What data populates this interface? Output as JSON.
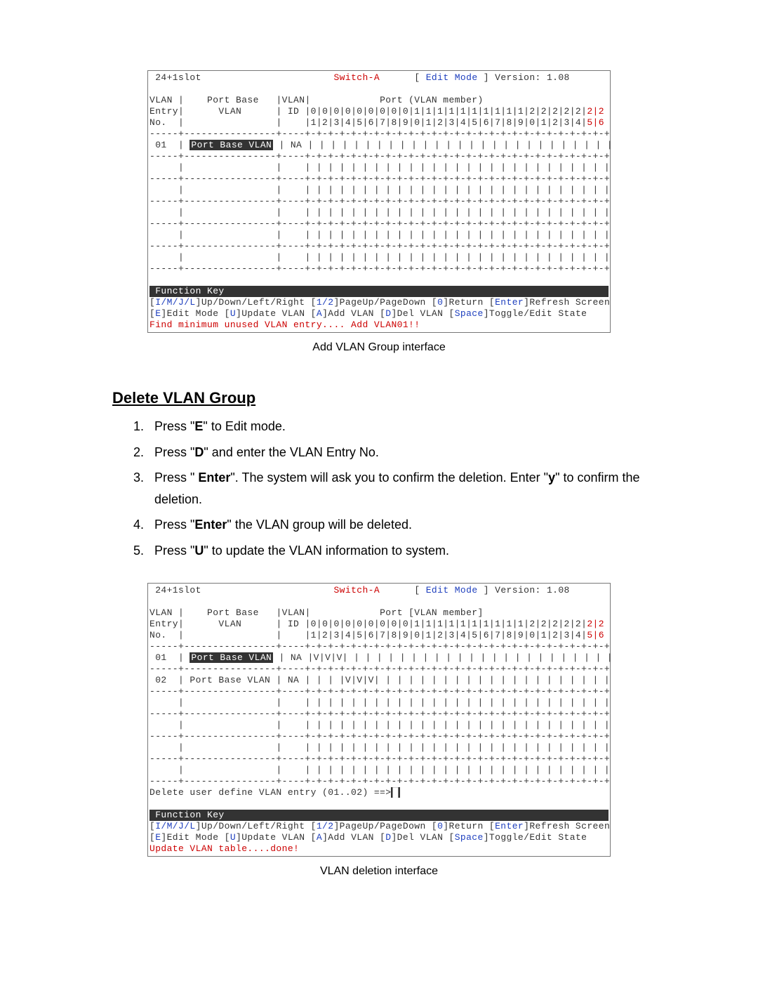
{
  "figure1": {
    "header_left": "24+1slot",
    "header_center": "Switch-A",
    "header_mode_l": "[ ",
    "header_mode": "Edit Mode",
    "header_mode_r": " ]",
    "header_version": "Version: 1.08",
    "col_entry_l1": "VLAN |",
    "col_entry_l2": "Entry|",
    "col_entry_l3": "No.  |",
    "col_base_l1": "    Port Base",
    "col_base_l2": "      VLAN",
    "col_vlanid_l1": "|VLAN|",
    "col_vlanid_l2": "| ID ",
    "port_header": "            Port (VLAN member)",
    "port_nums_l1": "|0|0|0|0|0|0|0|0|0|1|1|1|1|1|1|1|1|1|1|2|2|2|2|2|",
    "port_nums_l1b": "2|2",
    "port_nums_l2": "|1|2|3|4|5|6|7|8|9|0|1|2|3|4|5|6|7|8|9|0|1|2|3|4|",
    "port_nums_l2b": "5|6",
    "row01_no": " 01  | ",
    "row01_name": "Port Base VLAN",
    "row01_vlanid": " | NA ",
    "row01_ports": "| | | | | | | | | | | | | | | | | | | | | | | | | | |",
    "blank_row_left": "     |                ",
    "blank_vlanid": "|    ",
    "blank_ports": "| | | | | | | | | | | | | | | | | | | | | | | | | | |",
    "divider": "-----+----------------+----+-+-+-+-+-+-+-+-+-+-+-+-+-+-+-+-+-+-+-+-+-+-+-+-+-+-+",
    "funckey_bar": " Function Key ",
    "help1a": "[",
    "help1b": "I/M/J/L",
    "help1c": "]Up/Down/Left/Right [",
    "help1d": "1/2",
    "help1e": "]PageUp/PageDown [",
    "help1f": "0",
    "help1g": "]Return [",
    "help1h": "Enter",
    "help1i": "]Refresh Screen",
    "help2a": "[",
    "help2b": "E",
    "help2c": "]Edit Mode [",
    "help2d": "U",
    "help2e": "]Update VLAN [",
    "help2f": "A",
    "help2g": "]Add VLAN [",
    "help2h": "D",
    "help2i": "]Del VLAN [",
    "help2j": "Space",
    "help2k": "]Toggle/Edit State",
    "status": "Find minimum unused VLAN entry.... Add VLAN01!!",
    "caption": "Add VLAN Group interface"
  },
  "section_heading": "Delete VLAN Group",
  "steps": [
    {
      "pre": "Press \"",
      "b": "E",
      "post": "\" to Edit mode."
    },
    {
      "pre": "Press \"",
      "b": "D",
      "post": "\" and enter the VLAN Entry No."
    },
    {
      "pre": "Press \" ",
      "b": "Enter",
      "post": "\". The system will ask you to confirm the deletion. Enter \"",
      "b2": "y",
      "post2": "\" to confirm the deletion."
    },
    {
      "pre": "Press \"",
      "b": "Enter",
      "post": "\" the VLAN group will be deleted."
    },
    {
      "pre": "Press \"",
      "b": "U",
      "post": "\" to update the VLAN information to system."
    }
  ],
  "figure2": {
    "header_left": "24+1slot",
    "header_center": "Switch-A",
    "header_mode_l": "[ ",
    "header_mode": "Edit Mode",
    "header_mode_r": " ]",
    "header_version": "Version: 1.08",
    "port_header": "            Port [VLAN member]",
    "row01_no": " 01  | ",
    "row01_name": "Port Base VLAN",
    "row01_vlanid": " | NA ",
    "row01_ports": "|V|V|V| | | | | | | | | | | | | | | | | | | | | | | |",
    "row02_no": " 02  | ",
    "row02_name": "Port Base VLAN",
    "row02_vlanid": " | NA ",
    "row02_ports": "| | | |V|V|V| | | | | | | | | | | | | | | | | | | | |",
    "prompt": "Delete user define VLAN entry (01..02) ==>",
    "cursor": "█",
    "status": "Update VLAN table....done!",
    "caption": "VLAN deletion interface"
  }
}
